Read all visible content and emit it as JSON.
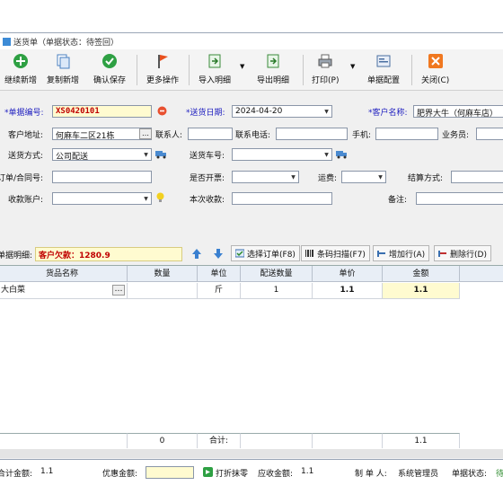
{
  "window": {
    "title": "送货单（单据状态：待签回）"
  },
  "toolbar": {
    "continue_new": "继续新增",
    "copy_new": "复制新增",
    "confirm_save": "确认保存",
    "more_ops": "更多操作",
    "import_detail": "导入明细",
    "export_detail": "导出明细",
    "print": "打印(P)",
    "doc_config": "单据配置",
    "close": "关闭(C)"
  },
  "form": {
    "doc_no_label": "*单据编号:",
    "doc_no_value": "XS0420101",
    "ship_date_label": "*送货日期:",
    "ship_date_value": "2024-04-20",
    "customer_label": "*客户名称:",
    "customer_value": "肥界大牛（何麻车店）",
    "address_label": "客户地址:",
    "address_value": "何麻车二区21栋",
    "contact_label": "联系人:",
    "contact_value": "",
    "phone_label": "联系电话:",
    "phone_value": "",
    "mobile_label": "手机:",
    "mobile_value": "",
    "salesman_label": "业务员:",
    "salesman_value": "",
    "ship_method_label": "送货方式:",
    "ship_method_value": "公司配送",
    "vehicle_label": "送货车号:",
    "vehicle_value": "",
    "order_no_label": "订单/合同号:",
    "order_no_value": "",
    "invoice_label": "是否开票:",
    "invoice_value": "",
    "freight_label": "运费:",
    "freight_value": "",
    "settle_label": "结算方式:",
    "settle_value": "",
    "account_label": "收款账户:",
    "account_value": "",
    "this_receipt_label": "本次收款:",
    "this_receipt_value": "",
    "remark_label": "备注:",
    "remark_value": ""
  },
  "detail": {
    "label": "单据明细:",
    "debt_text": "客户欠款：1280.9",
    "select_order": "选择订单(F8)",
    "barcode_scan": "条码扫描(F7)",
    "add_row": "增加行(A)",
    "delete_row": "删除行(D)"
  },
  "grid": {
    "columns": [
      "货品名称",
      "数量",
      "单位",
      "配送数量",
      "单价",
      "金额"
    ],
    "rows": [
      {
        "name": "大白菜",
        "qty": "",
        "unit": "斤",
        "ship_qty": "1",
        "price": "1.1",
        "amount": "1.1"
      }
    ],
    "footer": {
      "qty": "0",
      "total_label": "合计:",
      "ship_qty": "",
      "price": "",
      "amount": "1.1"
    }
  },
  "footer": {
    "total_label": "合计金额:",
    "total_value": "1.1",
    "discount_label": "优惠金额:",
    "discount_value": "",
    "round_label": "打折抹零",
    "receivable_label": "应收金额:",
    "receivable_value": "1.1",
    "maker_label": "制 单 人:",
    "maker_value": "系统管理员",
    "status_label": "单据状态:",
    "status_value": "待"
  },
  "colors": {
    "required_label": "#2020c0",
    "debt_text": "#c00000",
    "header_bg": "#e8eef6"
  }
}
